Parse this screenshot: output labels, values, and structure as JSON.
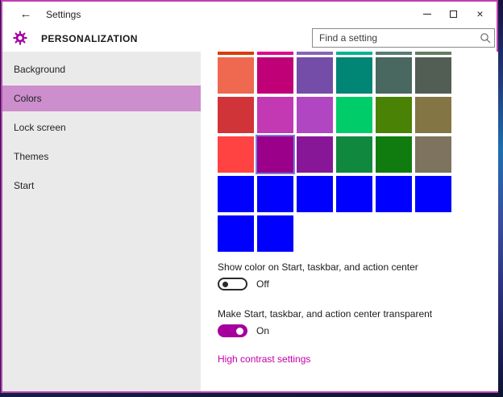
{
  "titlebar": {
    "title": "Settings"
  },
  "header": {
    "title": "PERSONALIZATION",
    "search": {
      "placeholder": "Find a setting"
    }
  },
  "sidebar": {
    "items": [
      {
        "label": "Background",
        "selected": false
      },
      {
        "label": "Colors",
        "selected": true
      },
      {
        "label": "Lock screen",
        "selected": false
      },
      {
        "label": "Themes",
        "selected": false
      },
      {
        "label": "Start",
        "selected": false
      }
    ]
  },
  "colors_page": {
    "palette": {
      "partial_top_row": [
        "#DA3B01",
        "#E3008C",
        "#8764B8",
        "#00B294",
        "#567C73",
        "#647C64"
      ],
      "rows": [
        [
          "#EF6950",
          "#BF0077",
          "#744DA9",
          "#018574",
          "#486860",
          "#525E54"
        ],
        [
          "#D13438",
          "#C239B3",
          "#B146C2",
          "#00CC6A",
          "#498205",
          "#847545"
        ],
        [
          "#FF4343",
          "#9A0089",
          "#881798",
          "#10893E",
          "#107C10",
          "#7E735F"
        ],
        [
          "#0000FF",
          "#0000FF",
          "#0000FF",
          "#0000FF",
          "#0000FF",
          "#0000FF"
        ],
        [
          "#0000FF",
          "#0000FF"
        ]
      ],
      "selected": {
        "row": 2,
        "col": 1
      }
    },
    "toggles": [
      {
        "label": "Show color on Start, taskbar, and action center",
        "state": "Off",
        "on": false
      },
      {
        "label": "Make Start, taskbar, and action center transparent",
        "state": "On",
        "on": true
      }
    ],
    "link_label": "High contrast settings"
  },
  "icons": {
    "back": "arrow-left-icon",
    "settings": "gear-icon",
    "search": "magnifier-icon",
    "window": [
      "minimize-icon",
      "maximize-icon",
      "close-icon"
    ]
  },
  "theme": {
    "accent": "#A5009E",
    "window_border": "#C03FB0",
    "sidebar_bg": "#EAEAEA",
    "sidebar_selected_bg": "#CD8ECD",
    "link_color": "#C400A8",
    "swatch_selected_outline": "#7B7BE6",
    "desktop_bg": "#0D1C3A"
  }
}
